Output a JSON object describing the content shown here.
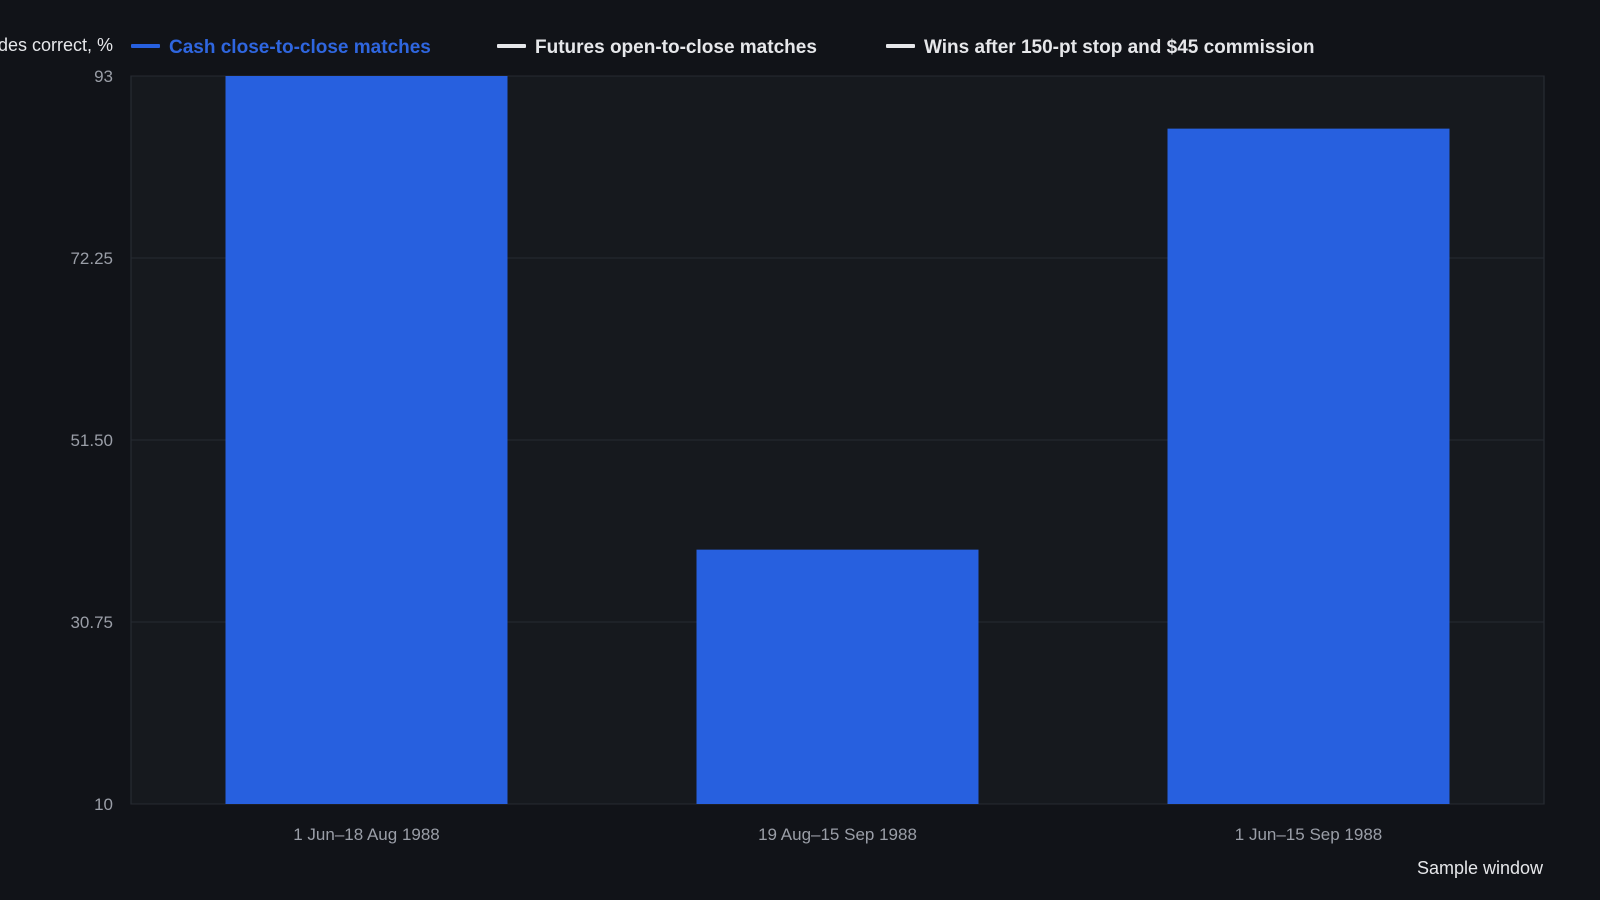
{
  "chart_data": {
    "type": "bar",
    "ylabel": "Sides correct, %",
    "xlabel": "Sample window",
    "categories": [
      "1 Jun–18 Aug 1988",
      "19 Aug–15 Sep 1988",
      "1 Jun–15 Sep 1988"
    ],
    "series": [
      {
        "name": "Cash close-to-close matches",
        "values": [
          93,
          39,
          87
        ],
        "color": "#2760df"
      },
      {
        "name": "Futures open-to-close matches",
        "values": [],
        "color": "#e6e7ea"
      },
      {
        "name": "Wins after 150-pt stop and $45 commission",
        "values": [],
        "color": "#e6e7ea"
      }
    ],
    "ylim": [
      10,
      93
    ],
    "yticks": [
      "10",
      "30.75",
      "51.50",
      "72.25",
      "93"
    ],
    "grid": true,
    "legend_position": "top"
  },
  "colors": {
    "background": "#111318",
    "plot_background": "#16191e",
    "grid": "#262a31",
    "active_legend_text": "#2f66df",
    "inactive_legend_text": "#e6e7ea"
  }
}
